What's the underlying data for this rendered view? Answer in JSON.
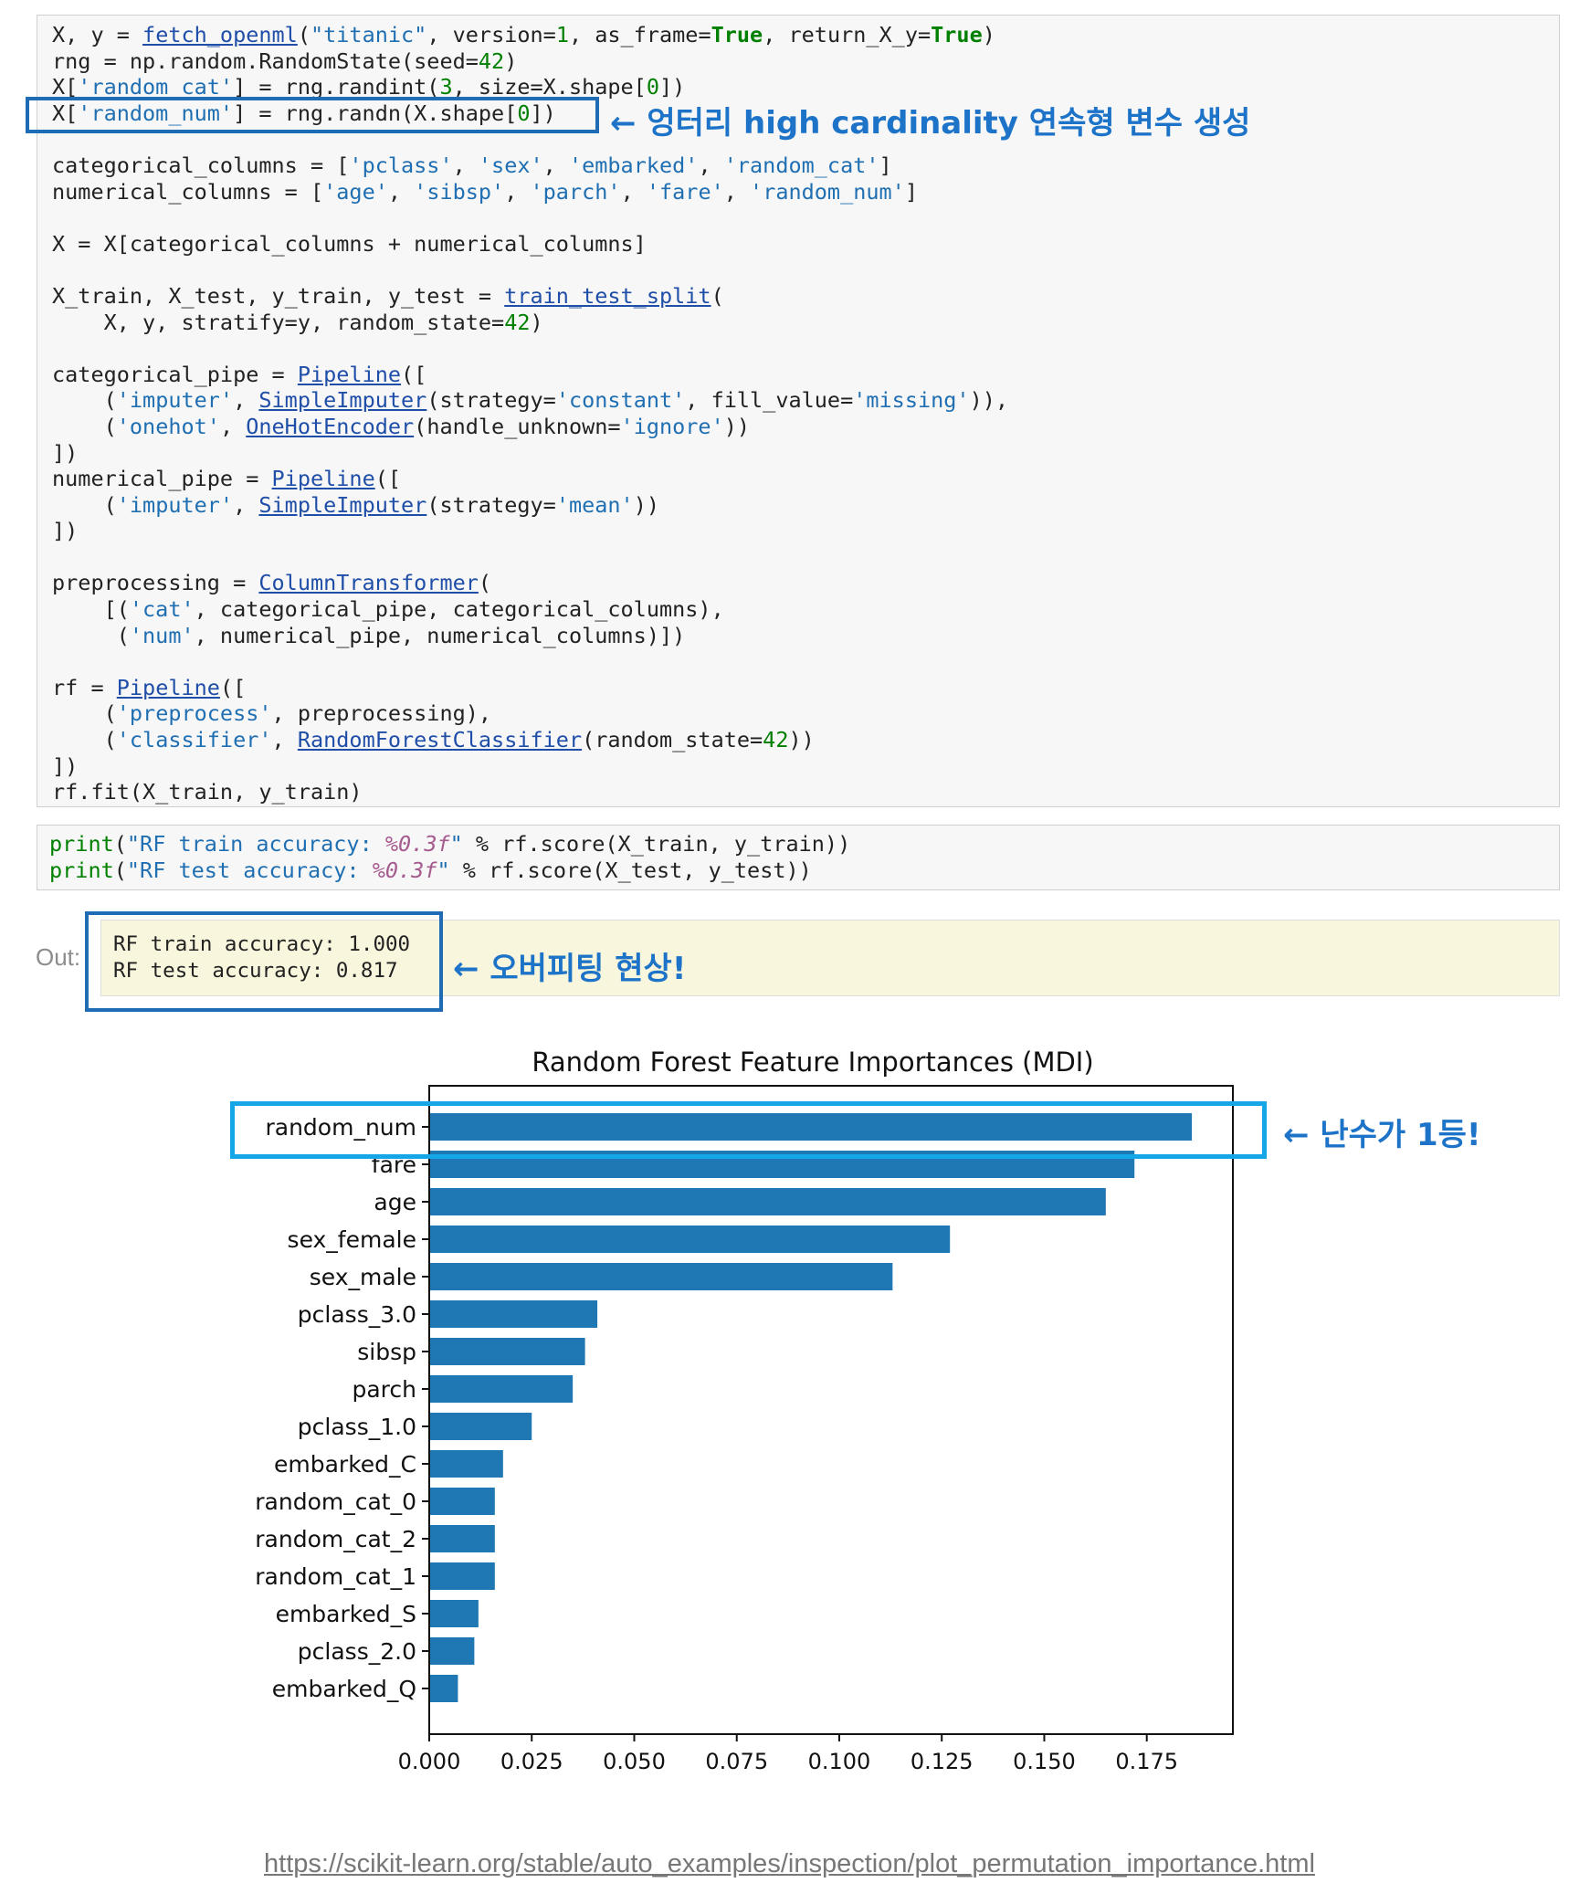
{
  "code_cell_1": {
    "lines": [
      "X, y = fetch_openml(\"titanic\", version=1, as_frame=True, return_X_y=True)",
      "rng = np.random.RandomState(seed=42)",
      "X['random_cat'] = rng.randint(3, size=X.shape[0])",
      "X['random_num'] = rng.randn(X.shape[0])",
      "",
      "categorical_columns = ['pclass', 'sex', 'embarked', 'random_cat']",
      "numerical_columns = ['age', 'sibsp', 'parch', 'fare', 'random_num']",
      "",
      "X = X[categorical_columns + numerical_columns]",
      "",
      "X_train, X_test, y_train, y_test = train_test_split(",
      "    X, y, stratify=y, random_state=42)",
      "",
      "categorical_pipe = Pipeline([",
      "    ('imputer', SimpleImputer(strategy='constant', fill_value='missing')),",
      "    ('onehot', OneHotEncoder(handle_unknown='ignore'))",
      "])",
      "numerical_pipe = Pipeline([",
      "    ('imputer', SimpleImputer(strategy='mean'))",
      "])",
      "",
      "preprocessing = ColumnTransformer(",
      "    [('cat', categorical_pipe, categorical_columns),",
      "     ('num', numerical_pipe, numerical_columns)])",
      "",
      "rf = Pipeline([",
      "    ('preprocess', preprocessing),",
      "    ('classifier', RandomForestClassifier(random_state=42))",
      "])",
      "rf.fit(X_train, y_train)"
    ]
  },
  "code_cell_2": {
    "lines": [
      "print(\"RF train accuracy: %0.3f\" % rf.score(X_train, y_train))",
      "print(\"RF test accuracy: %0.3f\" % rf.score(X_test, y_test))"
    ]
  },
  "output": {
    "label": "Out:",
    "lines": [
      "RF train accuracy: 1.000",
      "RF test accuracy: 0.817"
    ]
  },
  "annotations": {
    "random_num": "← 엉터리 high cardinality 연속형 변수 생성",
    "overfitting": "← 오버피팅 현상!",
    "rank1": "← 난수가 1등!"
  },
  "colors": {
    "bar": "#1f77b4",
    "annotation_text": "#1c73c8",
    "box_dark": "#1f6bb4",
    "box_cyan": "#14a6e6",
    "output_bg": "#f8f6dc"
  },
  "chart_data": {
    "type": "bar",
    "orientation": "horizontal",
    "title": "Random Forest Feature Importances (MDI)",
    "xlabel": "",
    "ylabel": "",
    "categories": [
      "random_num",
      "fare",
      "age",
      "sex_female",
      "sex_male",
      "pclass_3.0",
      "sibsp",
      "parch",
      "pclass_1.0",
      "embarked_C",
      "random_cat_0",
      "random_cat_2",
      "random_cat_1",
      "embarked_S",
      "pclass_2.0",
      "embarked_Q"
    ],
    "values": [
      0.186,
      0.172,
      0.165,
      0.127,
      0.113,
      0.041,
      0.038,
      0.035,
      0.025,
      0.018,
      0.016,
      0.016,
      0.016,
      0.012,
      0.011,
      0.007
    ],
    "xlim": [
      0,
      0.196
    ],
    "xticks": [
      "0.000",
      "0.025",
      "0.050",
      "0.075",
      "0.100",
      "0.125",
      "0.150",
      "0.175"
    ],
    "grid": false
  },
  "footer": {
    "link": "https://scikit-learn.org/stable/auto_examples/inspection/plot_permutation_importance.html"
  }
}
